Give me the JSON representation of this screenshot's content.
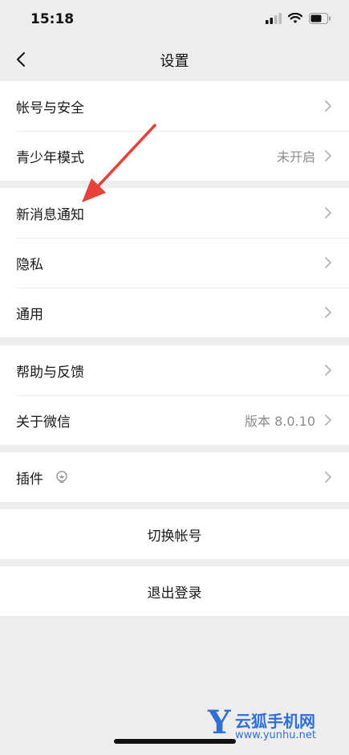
{
  "status_bar": {
    "time": "15:18"
  },
  "nav": {
    "title": "设置"
  },
  "groups": [
    {
      "items": [
        {
          "label": "帐号与安全",
          "value": ""
        },
        {
          "label": "青少年模式",
          "value": "未开启"
        }
      ]
    },
    {
      "items": [
        {
          "label": "新消息通知",
          "value": ""
        },
        {
          "label": "隐私",
          "value": ""
        },
        {
          "label": "通用",
          "value": ""
        }
      ]
    },
    {
      "items": [
        {
          "label": "帮助与反馈",
          "value": ""
        },
        {
          "label": "关于微信",
          "value": "版本 8.0.10"
        }
      ]
    },
    {
      "items": [
        {
          "label": "插件",
          "value": ""
        }
      ]
    }
  ],
  "actions": {
    "switch_account": "切换帐号",
    "logout": "退出登录"
  },
  "watermark": {
    "letter": "Y",
    "text": "云狐手机网",
    "url": "www.yunhu.net"
  },
  "colors": {
    "background": "#ededed",
    "annotation_arrow": "#e8403b",
    "watermark": "#2f6fd6"
  }
}
